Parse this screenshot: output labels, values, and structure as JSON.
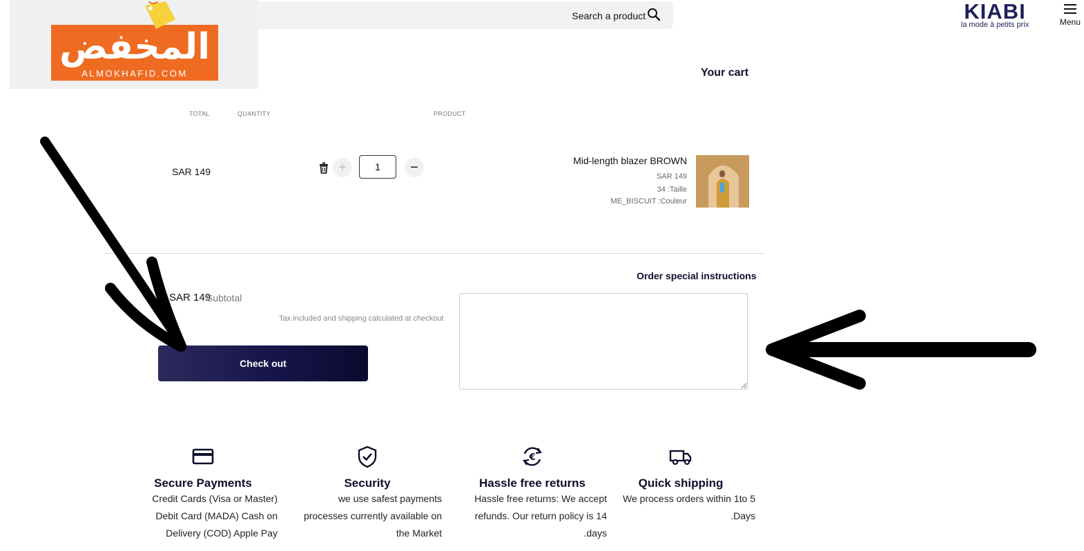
{
  "header": {
    "search_placeholder": "Search a product",
    "logo_arabic": "المخفض",
    "logo_sub": "ALMOKHAFID.COM",
    "brand_name": "KIABI",
    "brand_tagline": "la mode à petits prix",
    "menu_label": "Menu"
  },
  "cart": {
    "title": "Your cart",
    "columns": {
      "total": "TOTAL",
      "quantity": "QUANTITY",
      "product": "PRODUCT"
    },
    "item": {
      "total": "SAR 149",
      "quantity": "1",
      "name": "Mid-length blazer BROWN",
      "price": "SAR 149",
      "size": "34 :Taille",
      "color": "ME_BISCUIT :Couleur"
    },
    "subtotal_value": "SAR 149",
    "subtotal_label": "Subtotal",
    "tax_note": "Tax included and shipping calculated at checkout",
    "checkout_label": "Check out",
    "order_instructions_label": "Order special instructions",
    "order_instructions_value": ""
  },
  "features": [
    {
      "icon": "credit-card-icon",
      "title": "Secure Payments",
      "lines": [
        "Credit Cards (Visa or Master)",
        "Debit Card (MADA) Cash on",
        "Delivery (COD) Apple Pay"
      ]
    },
    {
      "icon": "shield-check-icon",
      "title": "Security",
      "lines": [
        "we use safest payments",
        "processes currently available on",
        "the Market"
      ]
    },
    {
      "icon": "euro-refresh-icon",
      "title": "Hassle free returns",
      "lines": [
        "Hassle free returns: We accept",
        "refunds. Our return policy is 14",
        ".days"
      ]
    },
    {
      "icon": "truck-icon",
      "title": "Quick shipping",
      "lines": [
        "We process orders within 1to 5",
        ".Days"
      ]
    }
  ],
  "colors": {
    "accent": "#1f1f5c",
    "checkout_bg": "#16154a",
    "logo_orange": "#ef6b22"
  }
}
